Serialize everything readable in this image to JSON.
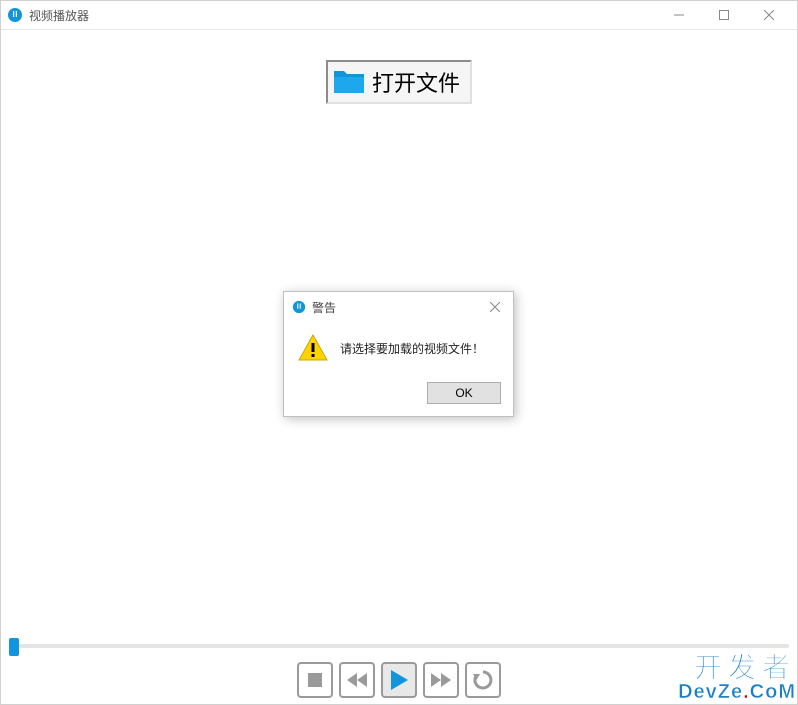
{
  "window": {
    "title": "视频播放器",
    "controls": {
      "minimize": "min",
      "maximize": "max",
      "close": "close"
    }
  },
  "main": {
    "open_file_label": "打开文件"
  },
  "slider": {
    "value": 0
  },
  "controls": {
    "stop": "stop",
    "rewind": "rewind",
    "play": "play",
    "forward": "forward",
    "repeat": "repeat"
  },
  "dialog": {
    "title": "警告",
    "message": "请选择要加载的视频文件！",
    "ok_label": "OK"
  },
  "watermark": {
    "line1": "开发者",
    "line2_a": "DevZe",
    "line2_sep": ".",
    "line2_b": "CoM"
  }
}
